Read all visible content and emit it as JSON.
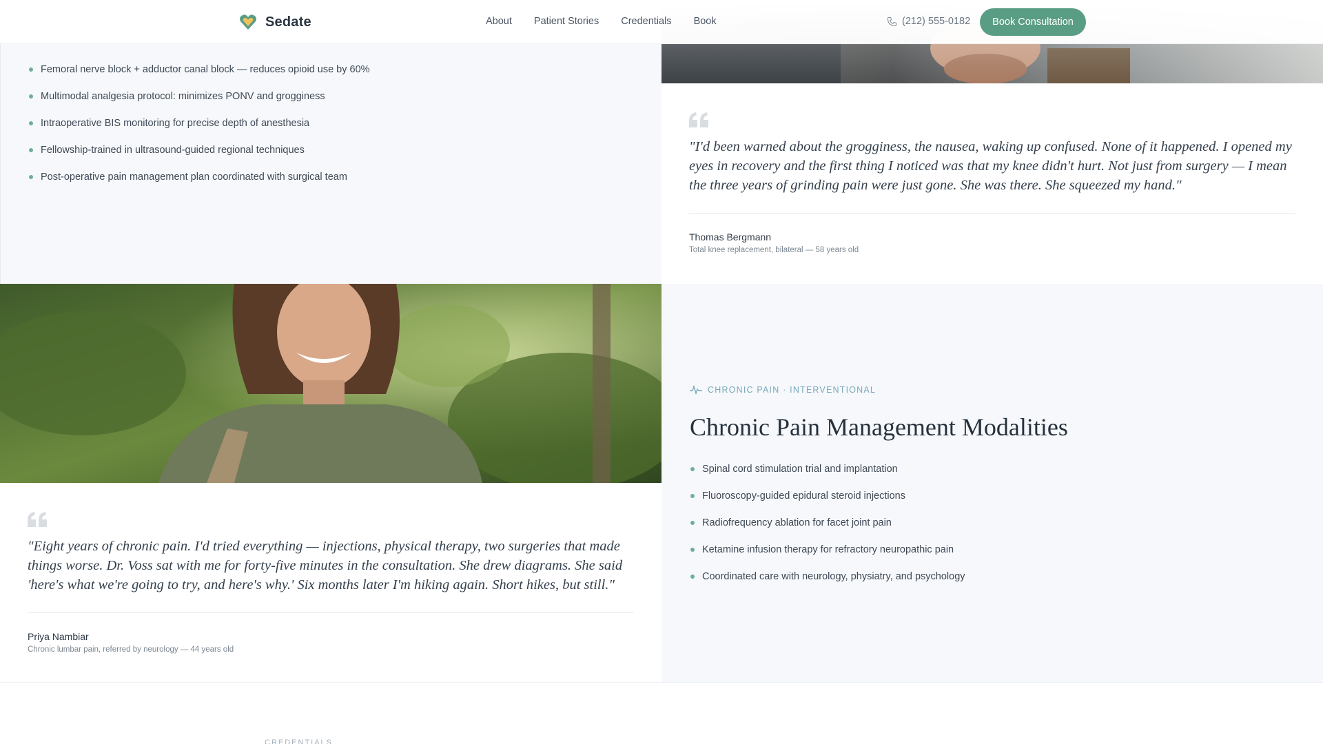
{
  "header": {
    "brand": "Sedate",
    "nav": [
      "About",
      "Patient Stories",
      "Credentials",
      "Book"
    ],
    "phone": "(212) 555-0182",
    "cta": "Book Consultation",
    "icons": [
      "heart-logo-icon",
      "phone-icon"
    ]
  },
  "knee_panel": {
    "items": [
      "Femoral nerve block + adductor canal block — reduces opioid use by 60%",
      "Multimodal analgesia protocol: minimizes PONV and grogginess",
      "Intraoperative BIS monitoring for precise depth of anesthesia",
      "Fellowship-trained in ultrasound-guided regional techniques",
      "Post-operative pain management plan coordinated with surgical team"
    ]
  },
  "testimonial_1": {
    "quote": "\"I'd been warned about the grogginess, the nausea, waking up confused. None of it happened. I opened my eyes in recovery and the first thing I noticed was that my knee didn't hurt. Not just from surgery — I mean the three years of grinding pain were just gone. She was there. She squeezed my hand.\"",
    "author": "Thomas Bergmann",
    "meta": "Total knee replacement, bilateral — 58 years old"
  },
  "testimonial_2": {
    "quote": "\"Eight years of chronic pain. I'd tried everything — injections, physical therapy, two surgeries that made things worse. Dr. Voss sat with me for forty-five minutes in the consultation. She drew diagrams. She said 'here's what we're going to try, and here's why.' Six months later I'm hiking again. Short hikes, but still.\"",
    "author": "Priya Nambiar",
    "meta": "Chronic lumbar pain, referred by neurology — 44 years old"
  },
  "chronic_panel": {
    "eyebrow": "CHRONIC PAIN · INTERVENTIONAL",
    "title": "Chronic Pain Management Modalities",
    "items": [
      "Spinal cord stimulation trial and implantation",
      "Fluoroscopy-guided epidural steroid injections",
      "Radiofrequency ablation for facet joint pain",
      "Ketamine infusion therapy for refractory neuropathic pain",
      "Coordinated care with neurology, physiatry, and psychology"
    ]
  },
  "footer": {
    "eyebrow": "CREDENTIALS"
  },
  "colors": {
    "accent": "#5a9d85",
    "bullet": "#6fae97",
    "eyebrow": "#7aa8bb"
  }
}
